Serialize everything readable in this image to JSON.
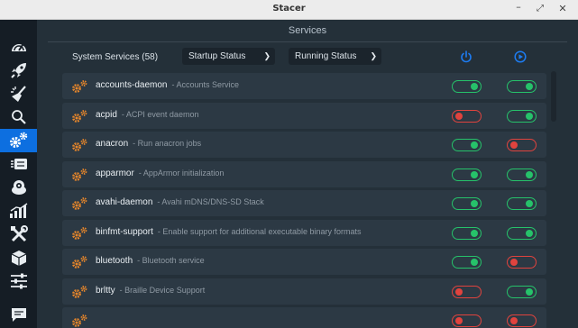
{
  "window": {
    "title": "Stacer",
    "minimize_glyph": "–",
    "maximize_glyph": "⤢",
    "close_glyph": "✕"
  },
  "sidebar": {
    "items": [
      {
        "name": "dashboard",
        "icon": "speedometer-icon",
        "active": false
      },
      {
        "name": "startup-apps",
        "icon": "rocket-icon",
        "active": false
      },
      {
        "name": "system-cleaner",
        "icon": "broom-icon",
        "active": false
      },
      {
        "name": "search",
        "icon": "search-icon",
        "active": false
      },
      {
        "name": "services",
        "icon": "gears-icon",
        "active": true
      },
      {
        "name": "processes",
        "icon": "processor-icon",
        "active": false
      },
      {
        "name": "uninstaller",
        "icon": "package-icon",
        "active": false
      },
      {
        "name": "resources",
        "icon": "bar-chart-icon",
        "active": false
      },
      {
        "name": "helpers",
        "icon": "tools-icon",
        "active": false
      },
      {
        "name": "apt-repository",
        "icon": "box-icon",
        "active": false
      },
      {
        "name": "settings",
        "icon": "sliders-icon",
        "active": false
      },
      {
        "name": "feedback",
        "icon": "message-icon",
        "active": false
      }
    ]
  },
  "main": {
    "heading": "Services",
    "toolbar": {
      "count_label": "System Services (58)",
      "startup_filter": "Startup Status",
      "running_filter": "Running Status",
      "startup_header_icon": "power-icon",
      "running_header_icon": "play-circle-icon"
    },
    "accent_color": "#0d6fe0",
    "on_color": "#26c26a",
    "off_color": "#e0433e"
  },
  "services": [
    {
      "name": "accounts-daemon",
      "description": "- Accounts Service",
      "startup": true,
      "running": true
    },
    {
      "name": "acpid",
      "description": "- ACPI event daemon",
      "startup": false,
      "running": true
    },
    {
      "name": "anacron",
      "description": "- Run anacron jobs",
      "startup": true,
      "running": false
    },
    {
      "name": "apparmor",
      "description": "- AppArmor initialization",
      "startup": true,
      "running": true
    },
    {
      "name": "avahi-daemon",
      "description": "- Avahi mDNS/DNS-SD Stack",
      "startup": true,
      "running": true
    },
    {
      "name": "binfmt-support",
      "description": "- Enable support for additional executable binary formats",
      "startup": true,
      "running": true
    },
    {
      "name": "bluetooth",
      "description": "- Bluetooth service",
      "startup": true,
      "running": false
    },
    {
      "name": "brltty",
      "description": "- Braille Device Support",
      "startup": false,
      "running": true
    },
    {
      "name": "",
      "description": "",
      "startup": false,
      "running": false
    }
  ]
}
